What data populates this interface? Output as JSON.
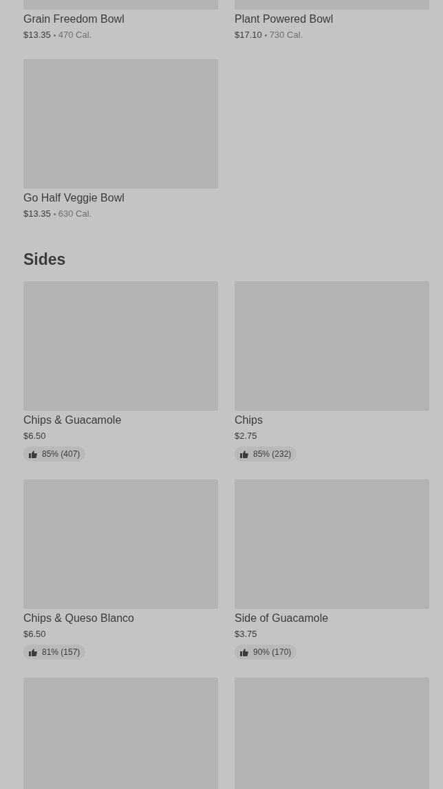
{
  "sections": [
    {
      "items": [
        {
          "kind": "full",
          "name": "Grain Freedom Bowl",
          "price": "$13.35",
          "calories": "470 Cal."
        },
        {
          "kind": "full",
          "name": "Plant Powered Bowl",
          "price": "$17.10",
          "calories": "730 Cal."
        },
        {
          "kind": "full",
          "name": "Go Half Veggie Bowl",
          "price": "$13.35",
          "calories": "630 Cal."
        }
      ]
    },
    {
      "title": "Sides",
      "items": [
        {
          "kind": "full",
          "name": "Chips & Guacamole",
          "price": "$6.50",
          "rating": "85% (407)"
        },
        {
          "kind": "full",
          "name": "Chips",
          "price": "$2.75",
          "rating": "85% (232)"
        },
        {
          "kind": "full",
          "name": "Chips & Queso Blanco",
          "price": "$6.50",
          "rating": "81% (157)"
        },
        {
          "kind": "full",
          "name": "Side of Guacamole",
          "price": "$3.75",
          "rating": "90% (170)"
        },
        {
          "kind": "image_only"
        },
        {
          "kind": "image_only"
        }
      ]
    }
  ]
}
